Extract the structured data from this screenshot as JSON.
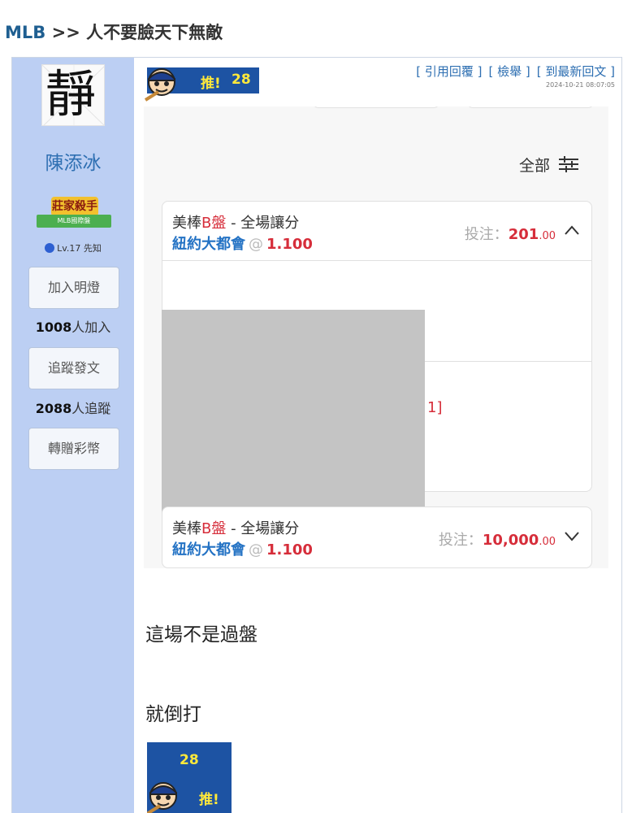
{
  "breadcrumb": {
    "forum": "MLB",
    "separator": " >> ",
    "title": "人不要臉天下無敵"
  },
  "user": {
    "avatar_char": "靜",
    "name": "陳添冰",
    "rank_title": "莊家殺手",
    "rank_board": "MLB國際盤",
    "level": "Lv.17 先知",
    "follow_light_label": "加入明燈",
    "light_count": "1008",
    "light_suffix": "人加入",
    "track_label": "追蹤發文",
    "track_count": "2088",
    "track_suffix": "人追蹤",
    "gift_label": "轉贈彩幣"
  },
  "post": {
    "push_label": "推!",
    "push_count": "28",
    "actions": {
      "quote": "[ 引用回覆 ]",
      "report": "[ 檢舉 ]",
      "latest": "[ 到最新回文 ]"
    },
    "timestamp": "2024-10-21 08:07:05",
    "filter_label": "全部",
    "bets": [
      {
        "market": "美棒",
        "market_red": "B盤",
        "type": " - 全場讓分",
        "team": "紐約大都會",
        "at": "@",
        "odds": "1.100",
        "amount_label": "投注：",
        "amount": "201",
        "amount_dec": ".00"
      },
      {
        "market": "美棒",
        "market_red": "B盤",
        "type": " - 全場讓分",
        "team": "紐約大都會",
        "at": "@",
        "odds": "1.100",
        "amount_label": "投注：",
        "amount": "10,000",
        "amount_dec": ".00"
      }
    ],
    "partial_text": "1]",
    "messages": [
      "這場不是過盤",
      "就倒打"
    ]
  },
  "colors": {
    "sidebar": "#bccff3",
    "link": "#2e6fb2",
    "accent_red": "#d62d3a",
    "team_blue": "#2372c4",
    "badge_blue": "#1d53a3"
  }
}
